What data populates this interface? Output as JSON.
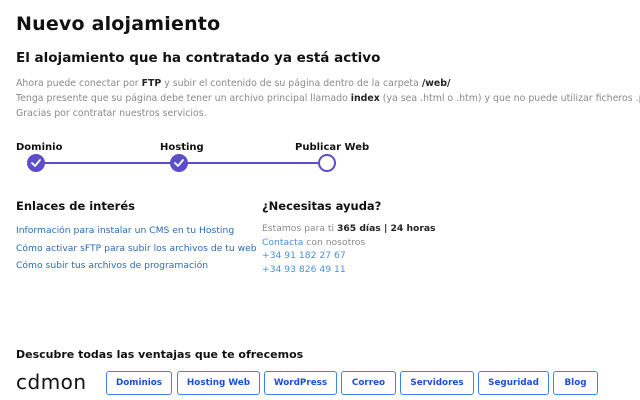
{
  "header": {
    "title": "Nuevo alojamiento",
    "subtitle": "El alojamiento que ha contratado ya está activo"
  },
  "intro": {
    "line1_a": "Ahora puede conectar por ",
    "line1_b": "FTP",
    "line1_c": " y subir el contenido de su página dentro de la carpeta ",
    "line1_d": "/web/",
    "line2_a": "Tenga presente que su página debe tener un archivo principal llamado ",
    "line2_b": "index",
    "line2_c": " (ya sea .html o .htm) y que no puede utilizar ficheros .php.",
    "line3": "Gracias por contratar nuestros servicios."
  },
  "stepper": {
    "steps": [
      {
        "label": "Dominio",
        "state": "done"
      },
      {
        "label": "Hosting",
        "state": "done"
      },
      {
        "label": "Publicar Web",
        "state": "current"
      }
    ],
    "color": "#5b4ec8"
  },
  "links_section": {
    "title": "Enlaces de interés",
    "links": [
      "Información para instalar un CMS en tu Hosting",
      "Cómo activar sFTP para subir los archivos de tu web",
      "Cómo subir tus archivos de programación"
    ]
  },
  "help": {
    "title": "¿Necesitas ayuda?",
    "hours_prefix": "Estamos para ti ",
    "hours_value": "365 días | 24 horas",
    "contact_link": "Contacta",
    "contact_suffix": " con nosotros",
    "phone1": "+34 91 182 27 67",
    "phone2": "+34 93 826 49 11"
  },
  "footer": {
    "benefits_title": "Descubre todas las ventajas que te ofrecemos",
    "logo_text": "cdmon",
    "buttons": [
      "Dominios",
      "Hosting Web",
      "WordPress",
      "Correo",
      "Servidores",
      "Seguridad",
      "Blog"
    ],
    "button_color": "#3b82f6"
  }
}
